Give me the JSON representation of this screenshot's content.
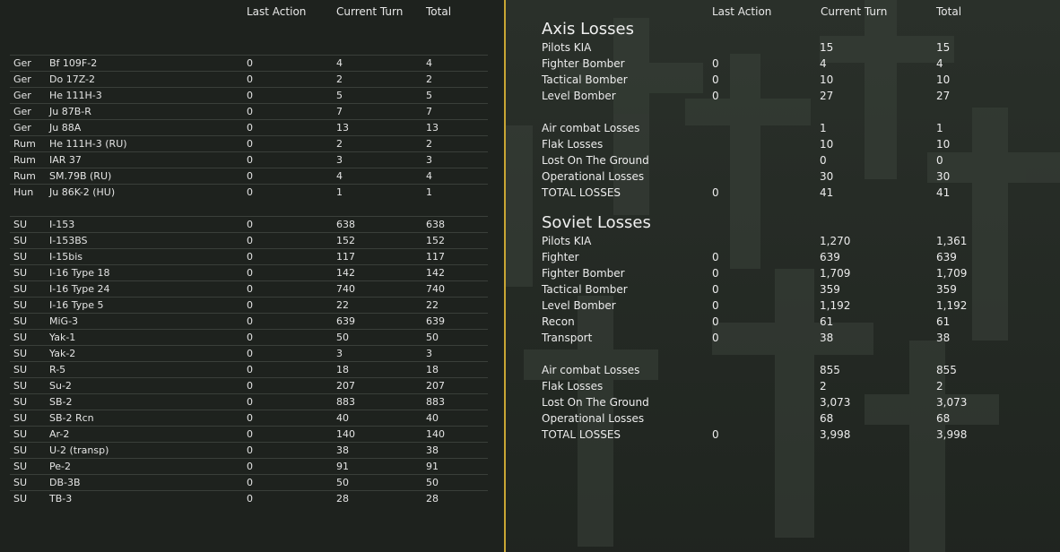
{
  "left": {
    "headers": {
      "last_action": "Last Action",
      "current_turn": "Current Turn",
      "total": "Total"
    },
    "axis_rows": [
      {
        "nat": "Ger",
        "type": "Bf 109F-2",
        "last": "0",
        "cur": "4",
        "tot": "4"
      },
      {
        "nat": "Ger",
        "type": "Do 17Z-2",
        "last": "0",
        "cur": "2",
        "tot": "2"
      },
      {
        "nat": "Ger",
        "type": "He 111H-3",
        "last": "0",
        "cur": "5",
        "tot": "5"
      },
      {
        "nat": "Ger",
        "type": "Ju 87B-R",
        "last": "0",
        "cur": "7",
        "tot": "7"
      },
      {
        "nat": "Ger",
        "type": "Ju 88A",
        "last": "0",
        "cur": "13",
        "tot": "13"
      },
      {
        "nat": "Rum",
        "type": "He 111H-3 (RU)",
        "last": "0",
        "cur": "2",
        "tot": "2"
      },
      {
        "nat": "Rum",
        "type": "IAR 37",
        "last": "0",
        "cur": "3",
        "tot": "3"
      },
      {
        "nat": "Rum",
        "type": "SM.79B (RU)",
        "last": "0",
        "cur": "4",
        "tot": "4"
      },
      {
        "nat": "Hun",
        "type": "Ju 86K-2 (HU)",
        "last": "0",
        "cur": "1",
        "tot": "1"
      }
    ],
    "soviet_rows": [
      {
        "nat": "SU",
        "type": "I-153",
        "last": "0",
        "cur": "638",
        "tot": "638"
      },
      {
        "nat": "SU",
        "type": "I-153BS",
        "last": "0",
        "cur": "152",
        "tot": "152"
      },
      {
        "nat": "SU",
        "type": "I-15bis",
        "last": "0",
        "cur": "117",
        "tot": "117"
      },
      {
        "nat": "SU",
        "type": "I-16 Type 18",
        "last": "0",
        "cur": "142",
        "tot": "142"
      },
      {
        "nat": "SU",
        "type": "I-16 Type 24",
        "last": "0",
        "cur": "740",
        "tot": "740"
      },
      {
        "nat": "SU",
        "type": "I-16 Type 5",
        "last": "0",
        "cur": "22",
        "tot": "22"
      },
      {
        "nat": "SU",
        "type": "MiG-3",
        "last": "0",
        "cur": "639",
        "tot": "639"
      },
      {
        "nat": "SU",
        "type": "Yak-1",
        "last": "0",
        "cur": "50",
        "tot": "50"
      },
      {
        "nat": "SU",
        "type": "Yak-2",
        "last": "0",
        "cur": "3",
        "tot": "3"
      },
      {
        "nat": "SU",
        "type": "R-5",
        "last": "0",
        "cur": "18",
        "tot": "18"
      },
      {
        "nat": "SU",
        "type": "Su-2",
        "last": "0",
        "cur": "207",
        "tot": "207"
      },
      {
        "nat": "SU",
        "type": "SB-2",
        "last": "0",
        "cur": "883",
        "tot": "883"
      },
      {
        "nat": "SU",
        "type": "SB-2 Rcn",
        "last": "0",
        "cur": "40",
        "tot": "40"
      },
      {
        "nat": "SU",
        "type": "Ar-2",
        "last": "0",
        "cur": "140",
        "tot": "140"
      },
      {
        "nat": "SU",
        "type": "U-2 (transp)",
        "last": "0",
        "cur": "38",
        "tot": "38"
      },
      {
        "nat": "SU",
        "type": "Pe-2",
        "last": "0",
        "cur": "91",
        "tot": "91"
      },
      {
        "nat": "SU",
        "type": "DB-3B",
        "last": "0",
        "cur": "50",
        "tot": "50"
      },
      {
        "nat": "SU",
        "type": "TB-3",
        "last": "0",
        "cur": "28",
        "tot": "28"
      }
    ]
  },
  "right": {
    "headers": {
      "last_action": "Last Action",
      "current_turn": "Current Turn",
      "total": "Total"
    },
    "axis": {
      "title": "Axis Losses",
      "rows_a": [
        {
          "label": "Pilots KIA",
          "last": "",
          "cur": "15",
          "tot": "15"
        },
        {
          "label": "Fighter Bomber",
          "last": "0",
          "cur": "4",
          "tot": "4"
        },
        {
          "label": "Tactical Bomber",
          "last": "0",
          "cur": "10",
          "tot": "10"
        },
        {
          "label": "Level Bomber",
          "last": "0",
          "cur": "27",
          "tot": "27"
        }
      ],
      "rows_b": [
        {
          "label": "Air combat Losses",
          "last": "",
          "cur": "1",
          "tot": "1"
        },
        {
          "label": "Flak Losses",
          "last": "",
          "cur": "10",
          "tot": "10"
        },
        {
          "label": "Lost On The Ground",
          "last": "",
          "cur": "0",
          "tot": "0"
        },
        {
          "label": "Operational Losses",
          "last": "",
          "cur": "30",
          "tot": "30"
        },
        {
          "label": "TOTAL LOSSES",
          "last": "0",
          "cur": "41",
          "tot": "41"
        }
      ]
    },
    "soviet": {
      "title": "Soviet Losses",
      "rows_a": [
        {
          "label": "Pilots KIA",
          "last": "",
          "cur": "1,270",
          "tot": "1,361"
        },
        {
          "label": "Fighter",
          "last": "0",
          "cur": "639",
          "tot": "639"
        },
        {
          "label": "Fighter Bomber",
          "last": "0",
          "cur": "1,709",
          "tot": "1,709"
        },
        {
          "label": "Tactical Bomber",
          "last": "0",
          "cur": "359",
          "tot": "359"
        },
        {
          "label": "Level Bomber",
          "last": "0",
          "cur": "1,192",
          "tot": "1,192"
        },
        {
          "label": "Recon",
          "last": "0",
          "cur": "61",
          "tot": "61"
        },
        {
          "label": "Transport",
          "last": "0",
          "cur": "38",
          "tot": "38"
        }
      ],
      "rows_b": [
        {
          "label": "Air combat Losses",
          "last": "",
          "cur": "855",
          "tot": "855"
        },
        {
          "label": "Flak Losses",
          "last": "",
          "cur": "2",
          "tot": "2"
        },
        {
          "label": "Lost On The Ground",
          "last": "",
          "cur": "3,073",
          "tot": "3,073"
        },
        {
          "label": "Operational Losses",
          "last": "",
          "cur": "68",
          "tot": "68"
        },
        {
          "label": "TOTAL LOSSES",
          "last": "0",
          "cur": "3,998",
          "tot": "3,998"
        }
      ]
    }
  },
  "colors": {
    "divider": "#c9a634",
    "left_bg": "#1e221e",
    "right_bg": "#2b312b"
  }
}
